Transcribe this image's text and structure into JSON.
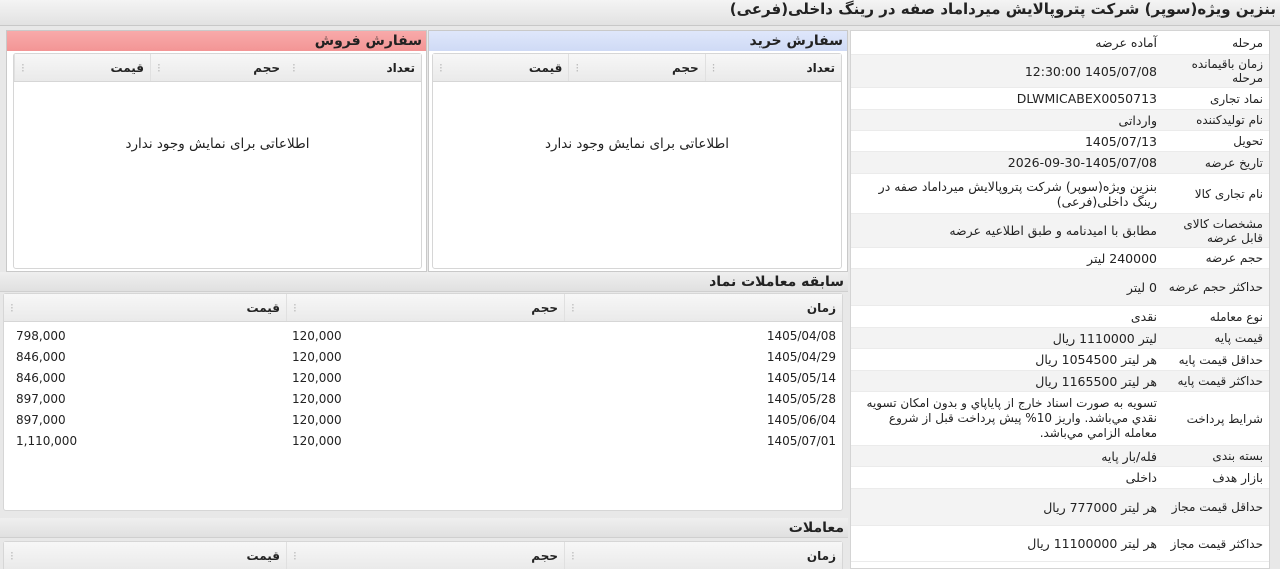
{
  "title": "بنزین ویژه(سوپر) شرکت پتروپالایش میرداماد صفه در رینگ داخلی(فرعی)",
  "info": [
    {
      "label": "مرحله",
      "value": "آماده عرضه"
    },
    {
      "label": "زمان باقیمانده مرحله",
      "value": "1405/07/08 12:30:00"
    },
    {
      "label": "نماد تجاری",
      "value": "DLWMICABEX0050713"
    },
    {
      "label": "نام تولیدکننده",
      "value": "وارداتی"
    },
    {
      "label": "تحویل",
      "value": "1405/07/13"
    },
    {
      "label": "تاریخ عرضه",
      "value": "2026-09-30-1405/07/08"
    },
    {
      "label": "نام تجاری کالا",
      "value": "بنزین ویژه(سوپر) شرکت پتروپالایش میرداماد صفه در رینگ داخلی(فرعی)"
    },
    {
      "label": "مشخصات کالای قابل عرضه",
      "value": "مطابق با امیدنامه و طبق اطلاعیه عرضه"
    },
    {
      "label": "حجم عرضه",
      "value": "240000 لیتر"
    },
    {
      "label": "حداکثر حجم عرضه",
      "value": "0 لیتر"
    },
    {
      "label": "نوع معامله",
      "value": "نقدی"
    },
    {
      "label": "قیمت پایه",
      "value": "لیتر 1110000 ریال"
    },
    {
      "label": "حداقل قیمت پایه",
      "value": "هر لیتر 1054500 ریال"
    },
    {
      "label": "حداکثر قیمت پایه",
      "value": "هر لیتر 1165500 ریال"
    },
    {
      "label": "شرایط پرداخت",
      "value": "تسویه به صورت اسناد خارج از پاياپاي و بدون امکان تسویه نقدي مي‌باشد. واريز 10% پيش پرداخت قبل از شروع معامله الزامي مي‌باشد."
    },
    {
      "label": "بسته بندی",
      "value": "فله/بار پایه"
    },
    {
      "label": "بازار هدف",
      "value": "داخلی"
    },
    {
      "label": "حداقل قیمت مجاز",
      "value": "هر لیتر 777000 ریال"
    },
    {
      "label": "حداکثر قیمت مجاز",
      "value": "هر لیتر 11100000 ریال"
    }
  ],
  "buy": {
    "title": "سفارش خرید",
    "cols": [
      "تعداد",
      "حجم",
      "قیمت"
    ],
    "empty": "اطلاعاتی برای نمایش وجود ندارد"
  },
  "sell": {
    "title": "سفارش فروش",
    "cols": [
      "قیمت",
      "حجم",
      "تعداد"
    ],
    "empty": "اطلاعاتی برای نمایش وجود ندارد"
  },
  "history": {
    "title": "سابقه معاملات نماد",
    "cols": [
      "زمان",
      "حجم",
      "قیمت"
    ],
    "rows": [
      [
        "1405/04/08",
        "120,000",
        "798,000"
      ],
      [
        "1405/04/29",
        "120,000",
        "846,000"
      ],
      [
        "1405/05/14",
        "120,000",
        "846,000"
      ],
      [
        "1405/05/28",
        "120,000",
        "897,000"
      ],
      [
        "1405/06/04",
        "120,000",
        "897,000"
      ],
      [
        "1405/07/01",
        "120,000",
        "1,110,000"
      ]
    ]
  },
  "trades": {
    "title": "معاملات",
    "cols": [
      "زمان",
      "حجم",
      "قیمت"
    ]
  }
}
